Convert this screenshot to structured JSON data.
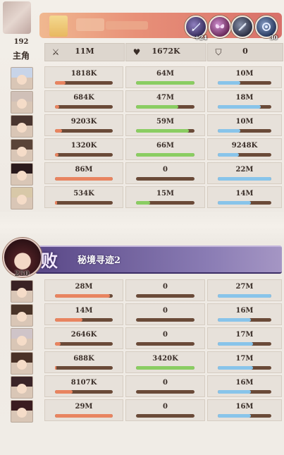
{
  "player": {
    "level": "192",
    "lead_label": "主角",
    "skills": [
      {
        "icon": "sword-skill-icon",
        "count": "+24"
      },
      {
        "icon": "wings-skill-icon",
        "count": ""
      },
      {
        "icon": "blade-skill-icon",
        "count": ""
      },
      {
        "icon": "swirl-skill-icon",
        "count": "30"
      }
    ],
    "summary": {
      "damage": "11M",
      "heal": "1672K",
      "tank": "0",
      "icons": {
        "damage": "crossed-swords-icon",
        "heal": "heart-icon",
        "tank": "shield-icon"
      }
    }
  },
  "colors": {
    "damage_bar": "#e88460",
    "heal_bar": "#8acd62",
    "tank_bar": "#88c4ea",
    "bar_track": "#6a4a38",
    "stage_banner": "#6e5e9a"
  },
  "allies": [
    {
      "damage": "1818K",
      "heal": "64M",
      "tank": "10M",
      "dmg_ratio": 0.18,
      "heal_ratio": 1.0,
      "tank_ratio": 0.42
    },
    {
      "damage": "684K",
      "heal": "47M",
      "tank": "18M",
      "dmg_ratio": 0.07,
      "heal_ratio": 0.72,
      "tank_ratio": 0.8
    },
    {
      "damage": "9203K",
      "heal": "59M",
      "tank": "10M",
      "dmg_ratio": 0.12,
      "heal_ratio": 0.9,
      "tank_ratio": 0.42
    },
    {
      "damage": "1320K",
      "heal": "66M",
      "tank": "9248K",
      "dmg_ratio": 0.06,
      "heal_ratio": 1.0,
      "tank_ratio": 0.4
    },
    {
      "damage": "86M",
      "heal": "0",
      "tank": "22M",
      "dmg_ratio": 1.0,
      "heal_ratio": 0.0,
      "tank_ratio": 1.0
    },
    {
      "damage": "534K",
      "heal": "15M",
      "tank": "14M",
      "dmg_ratio": 0.04,
      "heal_ratio": 0.24,
      "tank_ratio": 0.62
    }
  ],
  "enemy": {
    "level": "250",
    "result": "败",
    "stage_name": "秘境寻迹2"
  },
  "enemies": [
    {
      "damage": "28M",
      "heal": "0",
      "tank": "27M",
      "dmg_ratio": 0.95,
      "heal_ratio": 0.0,
      "tank_ratio": 1.0
    },
    {
      "damage": "14M",
      "heal": "0",
      "tank": "16M",
      "dmg_ratio": 0.48,
      "heal_ratio": 0.0,
      "tank_ratio": 0.62
    },
    {
      "damage": "2646K",
      "heal": "0",
      "tank": "17M",
      "dmg_ratio": 0.1,
      "heal_ratio": 0.0,
      "tank_ratio": 0.66
    },
    {
      "damage": "688K",
      "heal": "3420K",
      "tank": "17M",
      "dmg_ratio": 0.03,
      "heal_ratio": 1.0,
      "tank_ratio": 0.66
    },
    {
      "damage": "8107K",
      "heal": "0",
      "tank": "16M",
      "dmg_ratio": 0.3,
      "heal_ratio": 0.0,
      "tank_ratio": 0.62
    },
    {
      "damage": "29M",
      "heal": "0",
      "tank": "16M",
      "dmg_ratio": 1.0,
      "heal_ratio": 0.0,
      "tank_ratio": 0.62
    }
  ]
}
